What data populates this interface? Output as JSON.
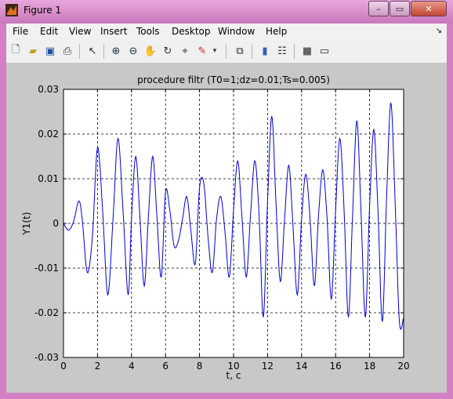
{
  "window": {
    "title": "Figure 1",
    "ghost_tabs": [
      "...",
      "...",
      "..."
    ]
  },
  "menu": [
    "File",
    "Edit",
    "View",
    "Insert",
    "Tools",
    "Desktop",
    "Window",
    "Help"
  ],
  "toolbar": [
    "new-icon",
    "open-icon",
    "save-icon",
    "print-icon",
    "pointer-icon",
    "zoom-in-icon",
    "zoom-out-icon",
    "pan-icon",
    "rotate-icon",
    "datacursor-icon",
    "brush-icon",
    "link-icon",
    "colorbar-icon",
    "legend-icon",
    "hide-tools-icon",
    "show-tools-icon"
  ],
  "chart_data": {
    "type": "line",
    "title": "procedure filtr (T0=1;dz=0.01;Ts=0.005)",
    "xlabel": "t, c",
    "ylabel": "Y1(t)",
    "xlim": [
      0,
      20
    ],
    "ylim": [
      -0.03,
      0.03
    ],
    "xticks": [
      "0",
      "2",
      "4",
      "6",
      "8",
      "10",
      "12",
      "14",
      "16",
      "18",
      "20"
    ],
    "yticks": [
      "0.03",
      "0.02",
      "0.01",
      "0",
      "-0.01",
      "-0.02",
      "-0.03"
    ],
    "grid": true,
    "color": "#0000d0",
    "x": [
      0,
      0.3,
      0.6,
      0.9,
      1.1,
      1.4,
      1.7,
      2.0,
      2.3,
      2.6,
      2.9,
      3.2,
      3.5,
      3.8,
      4.0,
      4.25,
      4.5,
      4.75,
      5.0,
      5.25,
      5.5,
      5.75,
      6.0,
      6.25,
      6.5,
      6.75,
      7.0,
      7.25,
      7.5,
      7.75,
      8.0,
      8.25,
      8.5,
      8.75,
      9.0,
      9.25,
      9.5,
      9.75,
      10.0,
      10.25,
      10.5,
      10.75,
      11.0,
      11.25,
      11.5,
      11.75,
      12.0,
      12.25,
      12.5,
      12.75,
      13.0,
      13.25,
      13.5,
      13.75,
      14.0,
      14.25,
      14.5,
      14.75,
      15.0,
      15.25,
      15.5,
      15.75,
      16.0,
      16.25,
      16.5,
      16.75,
      17.0,
      17.25,
      17.5,
      17.75,
      18.0,
      18.25,
      18.5,
      18.75,
      19.0,
      19.25,
      19.5,
      19.75,
      20.0
    ],
    "y": [
      0,
      -0.0015,
      0.0005,
      0.005,
      0.001,
      -0.011,
      -0.003,
      0.017,
      0.003,
      -0.016,
      0.0,
      0.019,
      0.003,
      -0.016,
      0.001,
      0.015,
      0.001,
      -0.014,
      0.002,
      0.015,
      0.001,
      -0.012,
      0.007,
      0.003,
      -0.005,
      -0.004,
      0.001,
      0.006,
      -0.002,
      -0.009,
      0.008,
      0.009,
      -0.003,
      -0.011,
      0.001,
      0.006,
      -0.002,
      -0.012,
      0.003,
      0.014,
      0.001,
      -0.012,
      0.002,
      0.014,
      0.002,
      -0.021,
      0.005,
      0.024,
      0.004,
      -0.013,
      0.001,
      0.013,
      -0.001,
      -0.016,
      0.001,
      0.011,
      0.001,
      -0.014,
      0.002,
      0.012,
      0.001,
      -0.017,
      0.003,
      0.019,
      0.003,
      -0.021,
      0.002,
      0.023,
      0.002,
      -0.021,
      0.004,
      0.021,
      0.002,
      -0.022,
      0.006,
      0.027,
      0.005,
      -0.022,
      -0.021
    ]
  }
}
